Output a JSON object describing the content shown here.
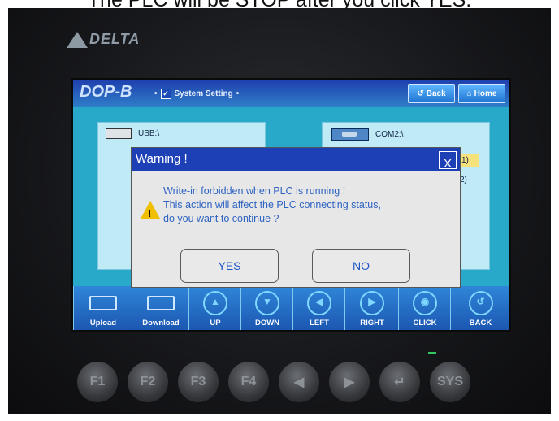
{
  "caption": "The PLC will be STOP after you click YES.",
  "device": {
    "brand": "DELTA",
    "keys": [
      "F1",
      "F2",
      "F3",
      "F4",
      "◀",
      "▶",
      "↵",
      "SYS"
    ]
  },
  "screen": {
    "brand_text": "DOP-B",
    "breadcrumb": "System Setting",
    "back_label": "Back",
    "home_label": "Home",
    "left_panel_title": "USB:\\",
    "right_panel_title": "COM2:\\",
    "right_item_1": "1)",
    "right_item_2": "2)",
    "bottom_buttons": [
      "Upload",
      "Download",
      "UP",
      "DOWN",
      "LEFT",
      "RIGHT",
      "CLICK",
      "BACK"
    ]
  },
  "dialog": {
    "title": "Warning !",
    "close_label": "X",
    "message_lines": [
      "Write-in forbidden when PLC is running !",
      "This action will affect the PLC connecting status,",
      "do you want to continue ?"
    ],
    "yes_label": "YES",
    "no_label": "NO"
  },
  "colors": {
    "title_bar": "#1d40b6",
    "message_text": "#2e63c2",
    "screen_bg": "#29a9c9"
  }
}
